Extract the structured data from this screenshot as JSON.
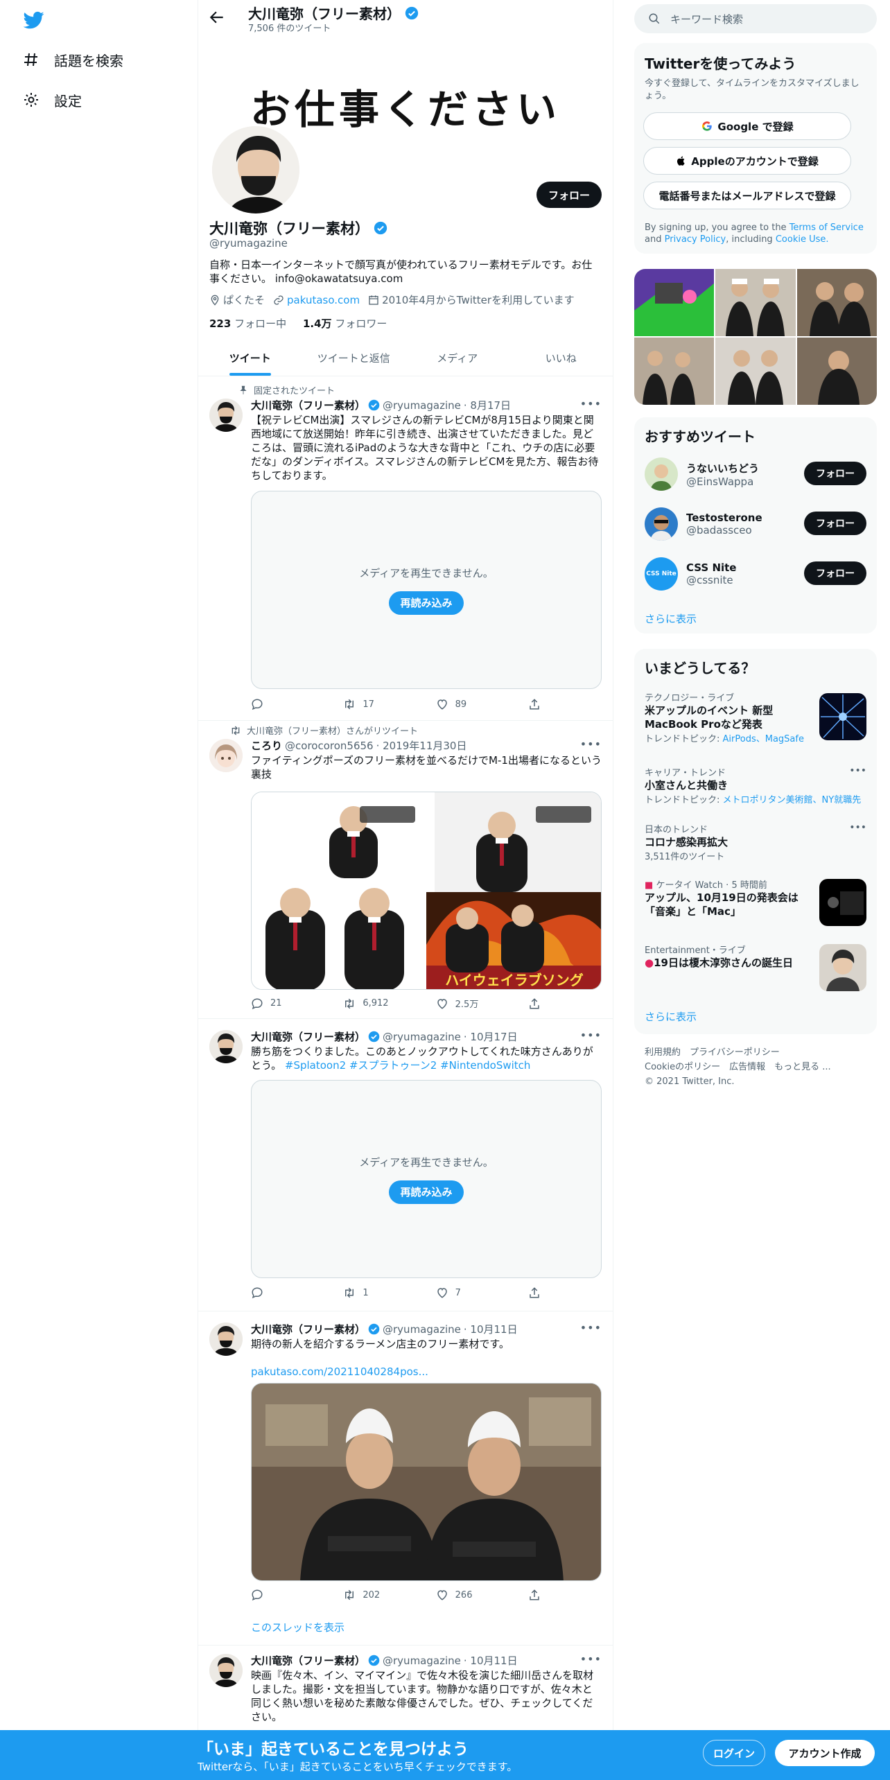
{
  "nav": {
    "explore_label": "話題を検索",
    "settings_label": "設定"
  },
  "header": {
    "name": "大川竜弥（フリー素材）",
    "tweet_count": "7,506 件のツイート"
  },
  "profile": {
    "banner_text": "お仕事ください",
    "follow_label": "フォロー",
    "name": "大川竜弥（フリー素材）",
    "handle": "@ryumagazine",
    "bio": "自称・日本一インターネットで顔写真が使われているフリー素材モデルです。お仕事ください。 info@okawatatsuya.com",
    "location": "ぱくたそ",
    "url": "pakutaso.com",
    "joined": "2010年4月からTwitterを利用しています",
    "following_count": "223",
    "following_label": "フォロー中",
    "followers_count": "1.4万",
    "followers_label": "フォロワー"
  },
  "tabs": [
    "ツイート",
    "ツイートと返信",
    "メディア",
    "いいね"
  ],
  "tweets": [
    {
      "context": "固定されたツイート",
      "name": "大川竜弥（フリー素材）",
      "handle": "@ryumagazine",
      "date": "· 8月17日",
      "text": "【祝テレビCM出演】スマレジさんの新テレビCMが8月15日より関東と関西地域にて放送開始！昨年に引き続き、出演させていただきました。見どころは、冒頭に流れるiPadのような大きな背中と「これ、ウチの店に必要だな」のダンディボイス。スマレジさんの新テレビCMを見た方、報告お待ちしております。",
      "media_error": "メディアを再生できません。",
      "reload_label": "再読み込み",
      "reply": "",
      "retweet": "17",
      "like": "89"
    },
    {
      "context": "大川竜弥（フリー素材）さんがリツイート",
      "name": "ころり",
      "handle": "@corocoron5656",
      "date": "· 2019年11月30日",
      "text": "ファイティングポーズのフリー素材を並べるだけでM-1出場者になるという裏技",
      "image_caption": "ハイウェイラブソング",
      "reply": "21",
      "retweet": "6,912",
      "like": "2.5万"
    },
    {
      "name": "大川竜弥（フリー素材）",
      "handle": "@ryumagazine",
      "date": "· 10月17日",
      "text": "勝ち筋をつくりました。このあとノックアウトしてくれた味方さんありがとう。",
      "hashtags": "#Splatoon2 #スプラトゥーン2 #NintendoSwitch",
      "media_error": "メディアを再生できません。",
      "reload_label": "再読み込み",
      "reply": "",
      "retweet": "1",
      "like": "7"
    },
    {
      "name": "大川竜弥（フリー素材）",
      "handle": "@ryumagazine",
      "date": "· 10月11日",
      "text": "期待の新人を紹介するラーメン店主のフリー素材です。",
      "link": "pakutaso.com/20211040284pos...",
      "reply": "",
      "retweet": "202",
      "like": "266",
      "thread_label": "このスレッドを表示"
    },
    {
      "name": "大川竜弥（フリー素材）",
      "handle": "@ryumagazine",
      "date": "· 10月11日",
      "text": "映画『佐々木、イン、マイマイン』で佐々木役を演じた細川岳さんを取材しました。撮影・文を担当しています。物静かな語り口ですが、佐々木と同じく熱い想いを秘めた素敵な俳優さんでした。ぜひ、チェックしてください。"
    }
  ],
  "sidebar": {
    "search_placeholder": "キーワード検索",
    "signup": {
      "title": "Twitterを使ってみよう",
      "subtitle": "今すぐ登録して、タイムラインをカスタマイズしましょう。",
      "google": "Google で登録",
      "apple": "Appleのアカウントで登録",
      "phone": "電話番号またはメールアドレスで登録",
      "terms_prefix": "By signing up, you agree to the",
      "terms": "Terms of Service",
      "and": "and",
      "privacy": "Privacy Policy",
      "including": ", including",
      "cookie": "Cookie Use."
    },
    "recommend": {
      "title": "おすすめツイート",
      "users": [
        {
          "name": "うないいちどう",
          "handle": "@EinsWappa",
          "button": "フォロー"
        },
        {
          "name": "Testosterone",
          "handle": "@badassceo",
          "button": "フォロー"
        },
        {
          "name": "CSS Nite",
          "handle": "@cssnite",
          "button": "フォロー",
          "avatar_text": "CSS Nite"
        }
      ],
      "more": "さらに表示"
    },
    "trends": {
      "title": "いまどうしてる？",
      "items": [
        {
          "category": "テクノロジー・ライブ",
          "title": "米アップルのイベント 新型MacBook Proなど発表",
          "sub_prefix": "トレンドトピック:",
          "sub_links": "AirPods、MagSafe"
        },
        {
          "category": "キャリア・トレンド",
          "title": "小室さんと共働き",
          "sub_prefix": "トレンドトピック:",
          "sub_links": "メトロポリタン美術館、NY就職先"
        },
        {
          "category": "日本のトレンド",
          "title": "コロナ感染再拡大",
          "sub": "3,511件のツイート"
        },
        {
          "category": "ケータイ Watch · 5 時間前",
          "title": "アップル、10月19日の発表会は「音楽」と「Mac」"
        },
        {
          "category": "Entertainment・ライブ",
          "title": "19日は榎木淳弥さんの誕生日"
        }
      ],
      "more": "さらに表示"
    },
    "footer": {
      "line1": "利用規約　プライバシーポリシー",
      "line2": "Cookieのポリシー　広告情報　もっと見る ...",
      "line3": "© 2021 Twitter, Inc."
    }
  },
  "bottom_bar": {
    "title": "「いま」起きていることを見つけよう",
    "subtitle": "Twitterなら、「いま」起きていることをいち早くチェックできます。",
    "login": "ログイン",
    "signup": "アカウント作成"
  },
  "colors": {
    "accent": "#1d9bf0",
    "text": "#0f1419",
    "secondary": "#536471",
    "border": "#eff3f4"
  }
}
